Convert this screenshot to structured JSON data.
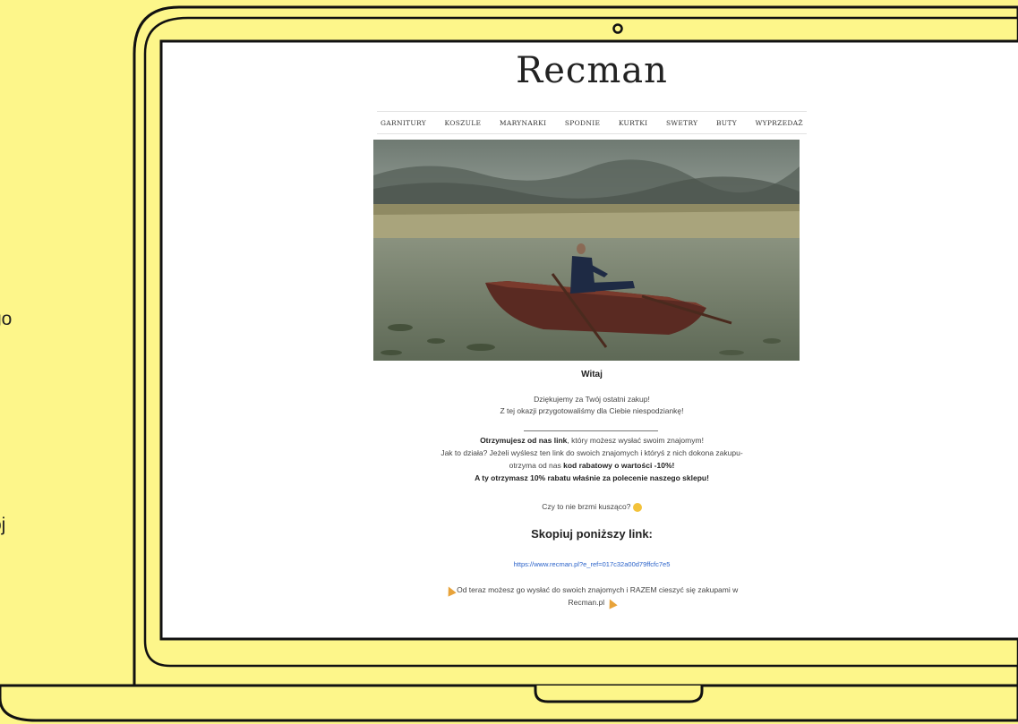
{
  "side_text": [
    "go",
    "ój"
  ],
  "email": {
    "logo": "Recman",
    "nav": [
      "GARNITURY",
      "KOSZULE",
      "MARYNARKI",
      "SPODNIE",
      "KURTKI",
      "SWETRY",
      "BUTY",
      "WYPRZEDAŻ"
    ],
    "greeting": "Witaj",
    "thanks_line1": "Dziękujemy za Twój ostatni zakup!",
    "thanks_line2": "Z tej okazji przygotowaliśmy dla Ciebie niespodziankę!",
    "offer_bold": "Otrzymujesz od nas link",
    "offer_rest": ", który możesz wysłać swoim znajomym!",
    "how_line1": "Jak to działa? Jeżeli wyślesz ten link do swoich znajomych i któryś z nich dokona zakupu-",
    "how_line2_pre": "otrzyma od nas ",
    "how_line2_bold": "kod rabatowy o wartości -10%!",
    "reward_line": "A ty otrzymasz 10% rabatu właśnie za polecenie naszego sklepu!",
    "question": "Czy to nie brzmi kusząco?",
    "copy_title": "Skopiuj poniższy link:",
    "link": "https://www.recman.pl?e_ref=017c32a00d79ffcfc7e5",
    "final_line1": "Od teraz możesz go wysłać do swoich znajomych i RAZEM cieszyć się zakupami w",
    "final_line2": "Recman.pl"
  },
  "colors": {
    "background": "#fdf68a",
    "link": "#2a62c9",
    "frame_stroke": "#111111"
  },
  "icons": [
    "webcam-icon",
    "smile-emoji-icon",
    "party-emoji-icon"
  ]
}
